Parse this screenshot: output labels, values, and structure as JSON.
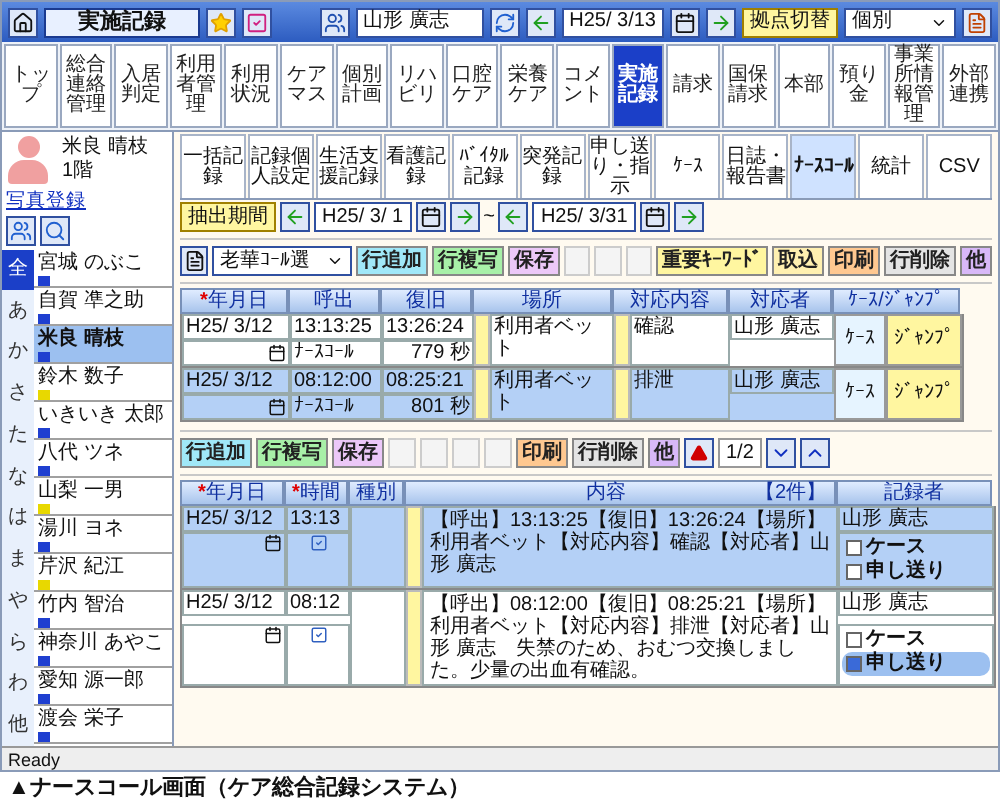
{
  "window": {
    "title": "実施記録",
    "user": "山形 廣志",
    "date": "H25/ 3/13",
    "site_button": "拠点切替",
    "site_select": "個別"
  },
  "menu": [
    {
      "label": "トップ",
      "selected": false
    },
    {
      "label": "総合連絡管理",
      "selected": false
    },
    {
      "label": "入居判定",
      "selected": false
    },
    {
      "label": "利用者管理",
      "selected": false
    },
    {
      "label": "利用状況",
      "selected": false
    },
    {
      "label": "ケアマス",
      "selected": false
    },
    {
      "label": "個別計画",
      "selected": false
    },
    {
      "label": "リハビリ",
      "selected": false
    },
    {
      "label": "口腔ケア",
      "selected": false
    },
    {
      "label": "栄養ケア",
      "selected": false
    },
    {
      "label": "コメント",
      "selected": false
    },
    {
      "label": "実施記録",
      "selected": true
    },
    {
      "label": "請求",
      "selected": false
    },
    {
      "label": "国保請求",
      "selected": false
    },
    {
      "label": "本部",
      "selected": false
    },
    {
      "label": "預り金",
      "selected": false
    },
    {
      "label": "事業所情報管理",
      "selected": false
    },
    {
      "label": "外部連携",
      "selected": false
    }
  ],
  "resident_panel": {
    "name": "米良 晴枝",
    "floor": "1階",
    "photo_link": "写真登録",
    "kana": [
      {
        "label": "全",
        "selected": true
      },
      {
        "label": "あ",
        "selected": false
      },
      {
        "label": "か",
        "selected": false
      },
      {
        "label": "さ",
        "selected": false
      },
      {
        "label": "た",
        "selected": false
      },
      {
        "label": "な",
        "selected": false
      },
      {
        "label": "は",
        "selected": false
      },
      {
        "label": "ま",
        "selected": false
      },
      {
        "label": "や",
        "selected": false
      },
      {
        "label": "ら",
        "selected": false
      },
      {
        "label": "わ",
        "selected": false
      },
      {
        "label": "他",
        "selected": false
      }
    ],
    "residents": [
      {
        "name": "宮城 のぶこ",
        "color": "#1f3fd0",
        "selected": false
      },
      {
        "name": "自賀 凖之助",
        "color": "#1f3fd0",
        "selected": false
      },
      {
        "name": "米良 晴枝",
        "color": "#1f3fd0",
        "selected": true
      },
      {
        "name": "鈴木 数子",
        "color": "#e8d800",
        "selected": false
      },
      {
        "name": "いきいき 太郎",
        "color": "#1f3fd0",
        "selected": false
      },
      {
        "name": "八代 ツネ",
        "color": "#1f3fd0",
        "selected": false
      },
      {
        "name": "山梨 一男",
        "color": "#e8d800",
        "selected": false
      },
      {
        "name": "湯川 ヨネ",
        "color": "#1f3fd0",
        "selected": false
      },
      {
        "name": "芹沢 紀江",
        "color": "#e8d800",
        "selected": false
      },
      {
        "name": "竹内 智治",
        "color": "#1f3fd0",
        "selected": false
      },
      {
        "name": "神奈川 あやこ",
        "color": "#1f3fd0",
        "selected": false
      },
      {
        "name": "愛知 源一郎",
        "color": "#1f3fd0",
        "selected": false
      },
      {
        "name": "渡会 栄子",
        "color": "#1f3fd0",
        "selected": false
      }
    ]
  },
  "sub_tabs": [
    {
      "label": "一括記録",
      "selected": false
    },
    {
      "label": "記録個人設定",
      "selected": false
    },
    {
      "label": "生活支援記録",
      "selected": false
    },
    {
      "label": "看護記録",
      "selected": false
    },
    {
      "label": "ﾊﾞｲﾀﾙ記録",
      "selected": false
    },
    {
      "label": "突発記録",
      "selected": false
    },
    {
      "label": "申し送り・指示",
      "selected": false
    },
    {
      "label": "ｹｰｽ",
      "selected": false
    },
    {
      "label": "日誌・報告書",
      "selected": false
    },
    {
      "label": "ﾅｰｽｺｰﾙ",
      "selected": true
    },
    {
      "label": "統計",
      "selected": false
    },
    {
      "label": "CSV",
      "selected": false
    }
  ],
  "period": {
    "label": "抽出期間",
    "from": "H25/ 3/ 1",
    "separator": "~",
    "to": "H25/ 3/31"
  },
  "call_toolbar": {
    "select": "老華ｺｰﾙ選",
    "buttons": [
      {
        "label": "行追加",
        "kind": "add"
      },
      {
        "label": "行複写",
        "kind": "copy"
      },
      {
        "label": "保存",
        "kind": "save"
      },
      {
        "label": "重要ｷｰﾜｰﾄﾞ",
        "kind": "keyword"
      },
      {
        "label": "取込",
        "kind": "import"
      },
      {
        "label": "印刷",
        "kind": "print"
      },
      {
        "label": "行削除",
        "kind": "delete"
      },
      {
        "label": "他",
        "kind": "other"
      }
    ]
  },
  "call_table": {
    "columns": [
      {
        "label": "年月日",
        "mark": "*"
      },
      {
        "label": "呼出"
      },
      {
        "label": "復旧"
      },
      {
        "label": "場所"
      },
      {
        "label": "対応内容"
      },
      {
        "label": "対応者"
      },
      {
        "label": "ｹｰｽ/ｼﾞｬﾝﾌﾟ"
      }
    ],
    "rows": [
      {
        "date": "H25/ 3/12",
        "call": "13:13:25",
        "recover": "13:26:24",
        "place": "利用者ベット",
        "content": "確認",
        "staff": "山形 廣志",
        "case": "ｹｰｽ",
        "jump": "ｼﾞｬﾝﾌﾟ",
        "type": "ﾅｰｽｺｰﾙ",
        "duration": "779",
        "unit": "秒",
        "selected": false
      },
      {
        "date": "H25/ 3/12",
        "call": "08:12:00",
        "recover": "08:25:21",
        "place": "利用者ベット",
        "content": "排泄",
        "staff": "山形 廣志",
        "case": "ｹｰｽ",
        "jump": "ｼﾞｬﾝﾌﾟ",
        "type": "ﾅｰｽｺｰﾙ",
        "duration": "801",
        "unit": "秒",
        "selected": true
      }
    ]
  },
  "record_toolbar": {
    "buttons": [
      {
        "label": "行追加",
        "kind": "add"
      },
      {
        "label": "行複写",
        "kind": "copy"
      },
      {
        "label": "保存",
        "kind": "save"
      },
      {
        "label": "印刷",
        "kind": "print"
      },
      {
        "label": "行削除",
        "kind": "delete"
      },
      {
        "label": "他",
        "kind": "other"
      }
    ],
    "page": "1/2"
  },
  "record_table": {
    "columns": [
      {
        "label": "年月日",
        "mark": "*"
      },
      {
        "label": "時間",
        "mark": "*"
      },
      {
        "label": "種別"
      },
      {
        "label": "内容"
      },
      {
        "label": "記録者"
      }
    ],
    "count": "【2件】",
    "rows": [
      {
        "date": "H25/ 3/12",
        "time": "13:13",
        "content": "【呼出】13:13:25【復旧】13:26:24【場所】利用者ベット【対応内容】確認【対応者】山形 廣志",
        "recorder": "山形 廣志",
        "case_label": "ケース",
        "case_checked": false,
        "handover_label": "申し送り",
        "handover_checked": false,
        "selected": true
      },
      {
        "date": "H25/ 3/12",
        "time": "08:12",
        "content": "【呼出】08:12:00【復旧】08:25:21【場所】利用者ベット【対応内容】排泄【対応者】山形 廣志　失禁のため、おむつ交換しました。少量の出血有確認。",
        "recorder": "山形 廣志",
        "case_label": "ケース",
        "case_checked": false,
        "handover_label": "申し送り",
        "handover_checked": true,
        "selected": false
      }
    ]
  },
  "status_bar": "Ready",
  "caption": "▲ナースコール画面（ケア総合記録システム）"
}
